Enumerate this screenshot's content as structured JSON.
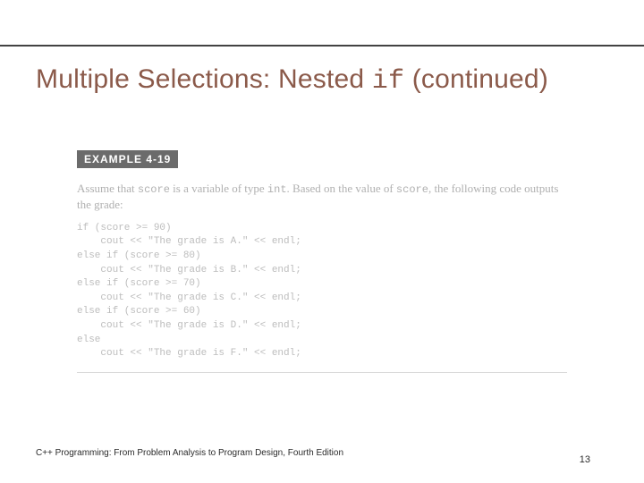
{
  "title": {
    "pre": "Multiple Selections: Nested ",
    "mono": "if",
    "post": " (continued)"
  },
  "example": {
    "badge": "EXAMPLE 4-19",
    "intro_pre": "Assume that ",
    "intro_var": "score",
    "intro_mid": " is a variable of type ",
    "intro_type": "int",
    "intro_post": ". Based on the value of ",
    "intro_var2": "score",
    "intro_tail": ", the following code outputs the grade:",
    "code": "if (score >= 90)\n    cout << \"The grade is A.\" << endl;\nelse if (score >= 80)\n    cout << \"The grade is B.\" << endl;\nelse if (score >= 70)\n    cout << \"The grade is C.\" << endl;\nelse if (score >= 60)\n    cout << \"The grade is D.\" << endl;\nelse\n    cout << \"The grade is F.\" << endl;"
  },
  "footer": "C++ Programming: From Problem Analysis to Program Design, Fourth Edition",
  "page_number": "13"
}
